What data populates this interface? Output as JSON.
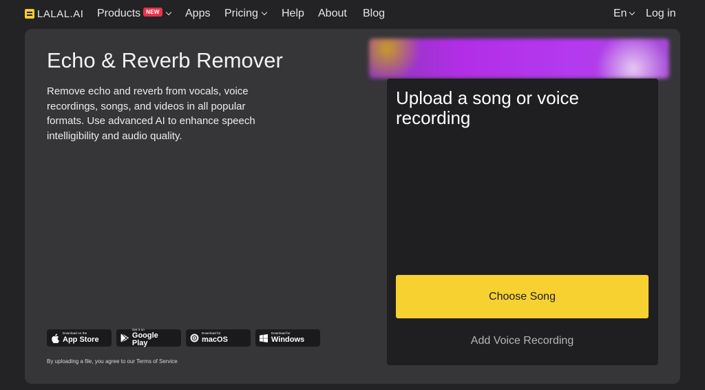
{
  "nav": {
    "logo_text": "LALAL.AI",
    "products": "Products",
    "products_badge": "NEW",
    "apps": "Apps",
    "pricing": "Pricing",
    "help": "Help",
    "about": "About",
    "blog": "Blog",
    "language": "En",
    "login": "Log in"
  },
  "hero": {
    "title": "Echo & Reverb Remover",
    "description": "Remove echo and reverb from vocals, voice recordings, songs, and videos in all popular formats. Use advanced AI to enhance speech intelligibility and audio quality."
  },
  "stores": [
    {
      "small": "Download on the",
      "big": "App Store",
      "icon": "apple-icon"
    },
    {
      "small": "Get it on",
      "big": "Google Play",
      "icon": "google-play-icon"
    },
    {
      "small": "Download for",
      "big": "macOS",
      "icon": "macos-icon"
    },
    {
      "small": "Download for",
      "big": "Windows",
      "icon": "windows-icon"
    }
  ],
  "terms": "By uploading a file, you agree to our Terms of Service",
  "upload": {
    "title": "Upload a song or voice recording",
    "choose_button": "Choose Song",
    "add_voice": "Add Voice Recording"
  },
  "colors": {
    "background": "#232225",
    "card": "#363538",
    "accent": "#f6d130",
    "badge": "#e8334a"
  }
}
